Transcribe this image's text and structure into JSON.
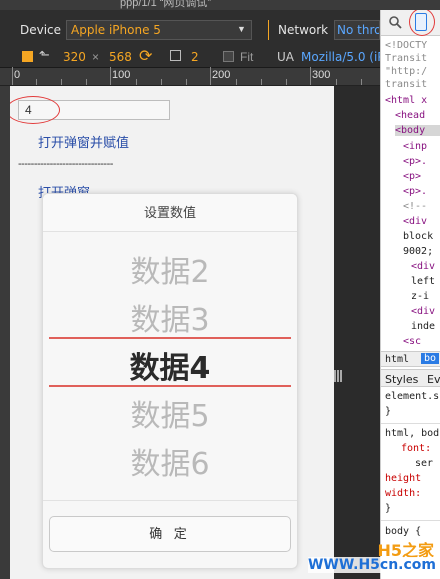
{
  "window": {
    "title_fragment": "ppp/1/1 “网页调试”"
  },
  "toolbar": {
    "device_label": "Device",
    "device_value": "Apple iPhone 5",
    "network_label": "Network",
    "network_value": "No thro",
    "width": "320",
    "times": "×",
    "height": "568",
    "zoom": "2",
    "fit_label": "Fit",
    "ua_label": "UA",
    "ua_value": "Mozilla/5.0 (iPh"
  },
  "ruler": {
    "labels": [
      "0",
      "100",
      "200",
      "300"
    ]
  },
  "page": {
    "input_value": "4",
    "open_assign_link": "打开弹窗并赋值",
    "dashes": "------------------------------",
    "open_link": "打开弹窗"
  },
  "picker": {
    "title": "设置数值",
    "items": [
      "数据2",
      "数据3",
      "数据4",
      "数据5",
      "数据6"
    ],
    "selected_index": 2,
    "confirm_label": "确 定",
    "accent_color": "#e0605a"
  },
  "devtools": {
    "lines": [
      "<!DOCTY",
      "Transit",
      "\"http:/",
      "transit",
      "<html x",
      "<head",
      "<body",
      "<inp",
      "<p>.",
      "<p>",
      "<p>.",
      "<!--",
      "<div",
      "block",
      "9002;",
      "<div",
      "left",
      "z-i",
      "<div",
      "inde",
      "<sc"
    ],
    "tab_html": "html",
    "tab_body": "bo",
    "subtab_styles": "Styles",
    "subtab_ev": "Ev",
    "style_lines": [
      "element.s",
      "}",
      "html, bod",
      "font:",
      "ser",
      "height",
      "width:",
      "}",
      "body {"
    ]
  },
  "watermark": {
    "brand": "H5之家",
    "url": "WWW.H5cn.com"
  }
}
